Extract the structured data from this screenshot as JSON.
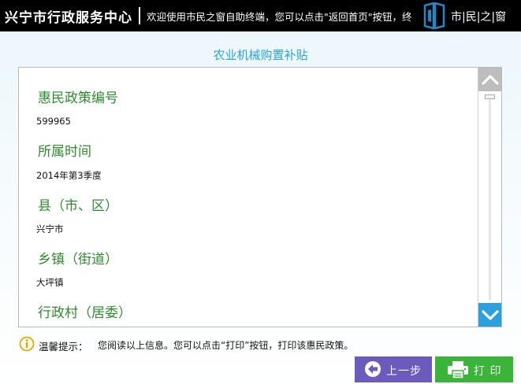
{
  "header": {
    "title": "兴宁市行政服务中心",
    "marquee": "欢迎使用市民之窗自助终端，您可以点击\"返回首页\"按钮，终",
    "logo_text": "市|民|之|窗"
  },
  "page_title": "农业机械购置补贴",
  "fields": [
    {
      "label": "惠民政策编号",
      "value": "599965"
    },
    {
      "label": "所属时间",
      "value": "2014年第3季度"
    },
    {
      "label": "县（市、区）",
      "value": "兴宁市"
    },
    {
      "label": "乡镇（街道）",
      "value": "大坪镇"
    },
    {
      "label": "行政村（居委）",
      "value": ""
    }
  ],
  "scroll": {
    "position": 0.0
  },
  "hint": {
    "label": "温馨提示：",
    "text": "您阅读以上信息。您可以点击“打印”按钮，打印该惠民政策。"
  },
  "buttons": {
    "prev_label": "上一步",
    "print_label": "打 印"
  },
  "colors": {
    "header_bg": "#000000",
    "title_blue": "#2aa3d6",
    "label_green": "#2e8b2e",
    "prev_purple": "#6a5bbd",
    "print_green": "#3ab53a",
    "scroll_down_blue": "#2aa0de"
  }
}
